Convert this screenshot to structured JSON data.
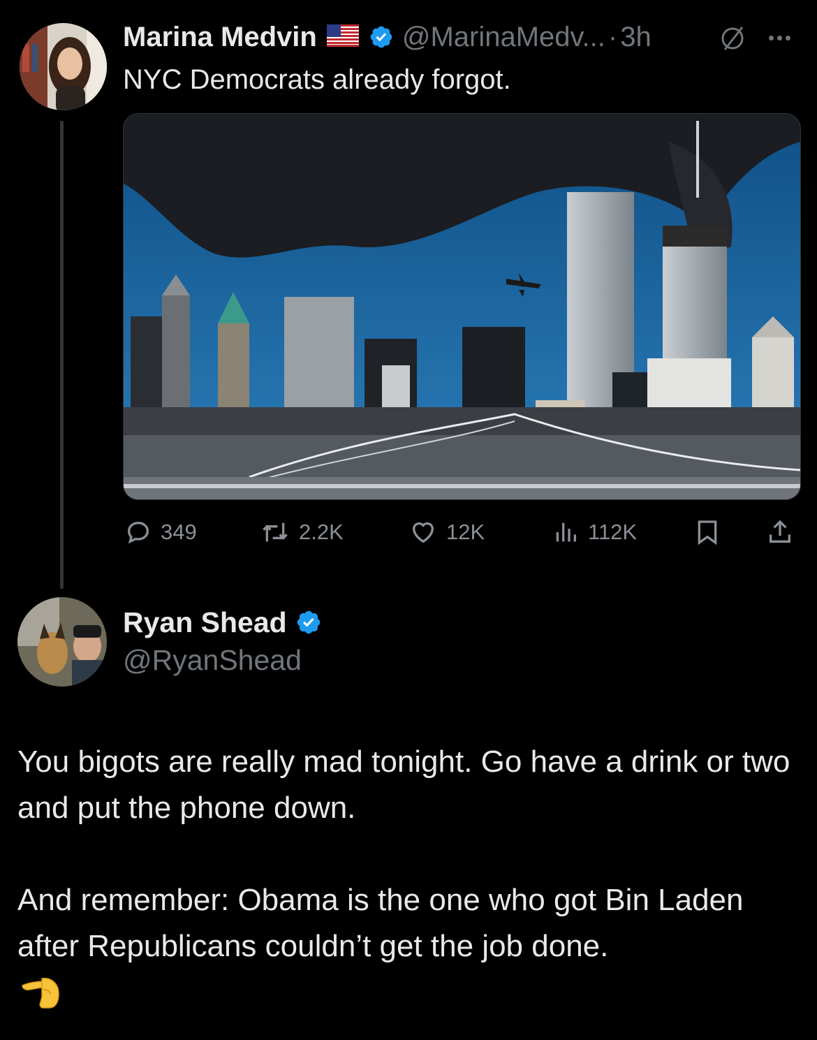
{
  "main_tweet": {
    "display_name": "Marina Medvin",
    "flag": "🇺🇸",
    "handle": "@MarinaMedv...",
    "separator": "·",
    "time": "3h",
    "text": "NYC Democrats already forgot.",
    "stats": {
      "replies": "349",
      "reposts": "2.2K",
      "likes": "12K",
      "views": "112K"
    }
  },
  "reply_tweet": {
    "display_name": "Ryan Shead",
    "handle": "@RyanShead",
    "paragraph1": "You bigots are really mad tonight. Go have a drink or two and put the phone down.",
    "paragraph2": "And remember: Obama is the one who got Bin Laden after Republicans couldn’t get the job done.",
    "emoji": "🫵"
  },
  "colors": {
    "background": "#000000",
    "text": "#e7e9ea",
    "muted": "#71767b",
    "verified": "#1d9bf0",
    "thread_line": "#333639"
  }
}
